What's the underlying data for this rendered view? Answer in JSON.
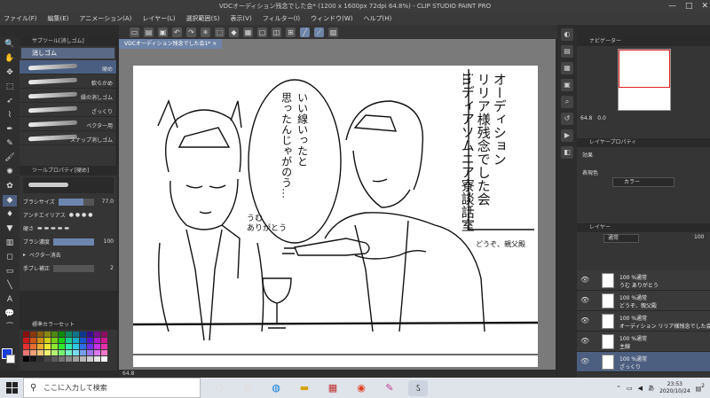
{
  "title": "VDCオーディション残念でした会* (1200 x 1600px 72dpi 64.8%) - CLIP STUDIO PAINT PRO",
  "menu": [
    "ファイル(F)",
    "編集(E)",
    "アニメーション(A)",
    "レイヤー(L)",
    "選択範囲(S)",
    "表示(V)",
    "フィルター(I)",
    "ウィンドウ(W)",
    "ヘルプ(H)"
  ],
  "document_tab": "VDCオーディション残念でした会1* ×",
  "subtool": {
    "header": "サブツール[消しゴム]",
    "tab": "消しゴム",
    "brushes": [
      "硬め",
      "軟らかめ",
      "縁の消しゴム",
      "ざっくり",
      "ベクター用",
      "スナップ消しゴム"
    ]
  },
  "tool_property": {
    "header": "ツールプロパティ[硬め]",
    "brush_size_label": "ブラシサイズ",
    "brush_size_value": "77.0",
    "brush_size_fraction": 0.7,
    "antialias_label": "アンチエイリアス",
    "hardness_label": "硬さ",
    "density_label": "ブラシ濃度",
    "density_value": "100",
    "density_fraction": 1.0,
    "vector_erase_label": "ベクター消去",
    "stabilization_label": "手ブレ補正",
    "stabilization_value": "2"
  },
  "color_set": {
    "label": "標準カラーセット"
  },
  "navigator": {
    "header": "ナビゲーター",
    "zoom": "64.8",
    "angle": "0.0"
  },
  "effect_panel": {
    "header": "レイヤープロパティ",
    "effect_label": "効果",
    "display_color_label": "表現色",
    "display_color_value": "カラー"
  },
  "layer_panel": {
    "header": "レイヤー",
    "blend_mode": "通常",
    "opacity": "100",
    "layers": [
      {
        "l1": "100 %通常",
        "l2": "うむ ありがとう"
      },
      {
        "l1": "100 %通常",
        "l2": "どうぞ、親父殿"
      },
      {
        "l1": "100 %通常",
        "l2": "オーディション リリア様残念でした会 inディア"
      },
      {
        "l1": "100 %通常",
        "l2": "主線"
      },
      {
        "l1": "100 %通常",
        "l2": "ざっくり"
      }
    ]
  },
  "canvas_status_zoom": "64.8",
  "artwork": {
    "title_lines": [
      "オーディション",
      "リリア様残念でした会",
      "inディアソムニア寮談話室"
    ],
    "speech_bubble": [
      "いい線いったと",
      "思ったんじゃがのう…"
    ],
    "reply": [
      "うむ",
      "ありがとう"
    ],
    "offer": "どうぞ、親父殿"
  },
  "taskbar": {
    "search_placeholder": "ここに入力して検索",
    "time": "23:53",
    "date": "2020/10/24",
    "ime": "あ",
    "notification_count": "2"
  },
  "colors": {
    "accent": "#6e84a8",
    "selected": "#4d5f80",
    "foreground": "#1a3cd8",
    "background": "#ffffff"
  }
}
